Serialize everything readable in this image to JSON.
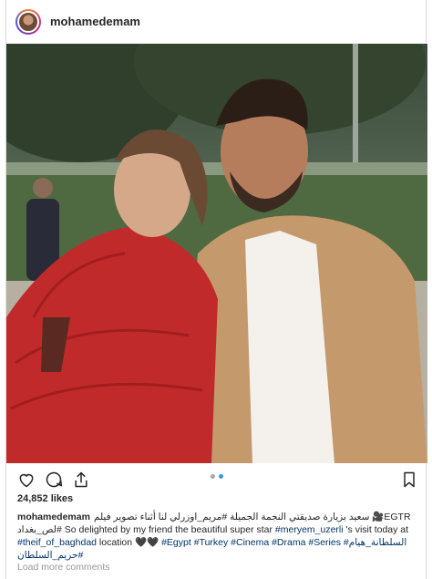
{
  "post": {
    "username": "mohamedemam",
    "likes": "24,852 likes",
    "caption": {
      "user": "mohamedemam",
      "text_1": "EGTR🎥 سعيد بزيارة صديقتي النجمة الجميلة #مريم_اوزرلي لنا أثناء تصوير فيلم  #لص_بغداد",
      "text_2": "So delighted by my friend the beautiful super star ",
      "tag_meryem": "#meryem_uzerli",
      "text_3": " 's visit today at",
      "tag_thief": "#theif_of_baghdad",
      "text_4": " location 🖤🖤 ",
      "tags_line": "#Egypt #Turkey #Cinema #Drama #Series #السلطانة_هيام",
      "tag_last": "#حريم_السلطان"
    },
    "load_comments": "Load more comments",
    "carousel": {
      "count": 2,
      "active": 1
    }
  },
  "icons": {
    "like": "heart-icon",
    "comment": "comment-icon",
    "share": "share-icon",
    "save": "bookmark-icon"
  },
  "colors": {
    "link": "#003569",
    "dot_active": "#3897f0",
    "dot_inactive": "#a8a8a8"
  }
}
